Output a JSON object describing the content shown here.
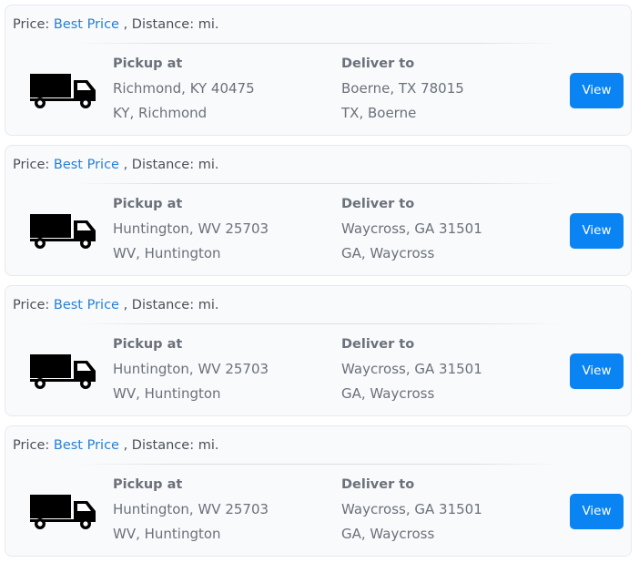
{
  "loads": [
    {
      "price_prefix": "Price: ",
      "price_link": "Best Price",
      "distance_text": " , Distance: mi.",
      "icon": "truck-icon",
      "pickup_heading": "Pickup at",
      "pickup_address": "Richmond, KY 40475",
      "pickup_region": "KY, Richmond",
      "deliver_heading": "Deliver to",
      "deliver_address": "Boerne, TX 78015",
      "deliver_region": "TX, Boerne",
      "button_label": "View"
    },
    {
      "price_prefix": "Price: ",
      "price_link": "Best Price",
      "distance_text": " , Distance: mi.",
      "icon": "truck-icon",
      "pickup_heading": "Pickup at",
      "pickup_address": "Huntington, WV 25703",
      "pickup_region": "WV, Huntington",
      "deliver_heading": "Deliver to",
      "deliver_address": "Waycross, GA 31501",
      "deliver_region": "GA, Waycross",
      "button_label": "View"
    },
    {
      "price_prefix": "Price: ",
      "price_link": "Best Price",
      "distance_text": " , Distance: mi.",
      "icon": "truck-icon",
      "pickup_heading": "Pickup at",
      "pickup_address": "Huntington, WV 25703",
      "pickup_region": "WV, Huntington",
      "deliver_heading": "Deliver to",
      "deliver_address": "Waycross, GA 31501",
      "deliver_region": "GA, Waycross",
      "button_label": "View"
    },
    {
      "price_prefix": "Price: ",
      "price_link": "Best Price",
      "distance_text": " , Distance: mi.",
      "icon": "truck-icon",
      "pickup_heading": "Pickup at",
      "pickup_address": "Huntington, WV 25703",
      "pickup_region": "WV, Huntington",
      "deliver_heading": "Deliver to",
      "deliver_address": "Waycross, GA 31501",
      "deliver_region": "GA, Waycross",
      "button_label": "View"
    }
  ],
  "colors": {
    "link": "#2481d6",
    "button": "#0a84f2",
    "card_background": "#f9fafc",
    "text": "#6b717a"
  }
}
